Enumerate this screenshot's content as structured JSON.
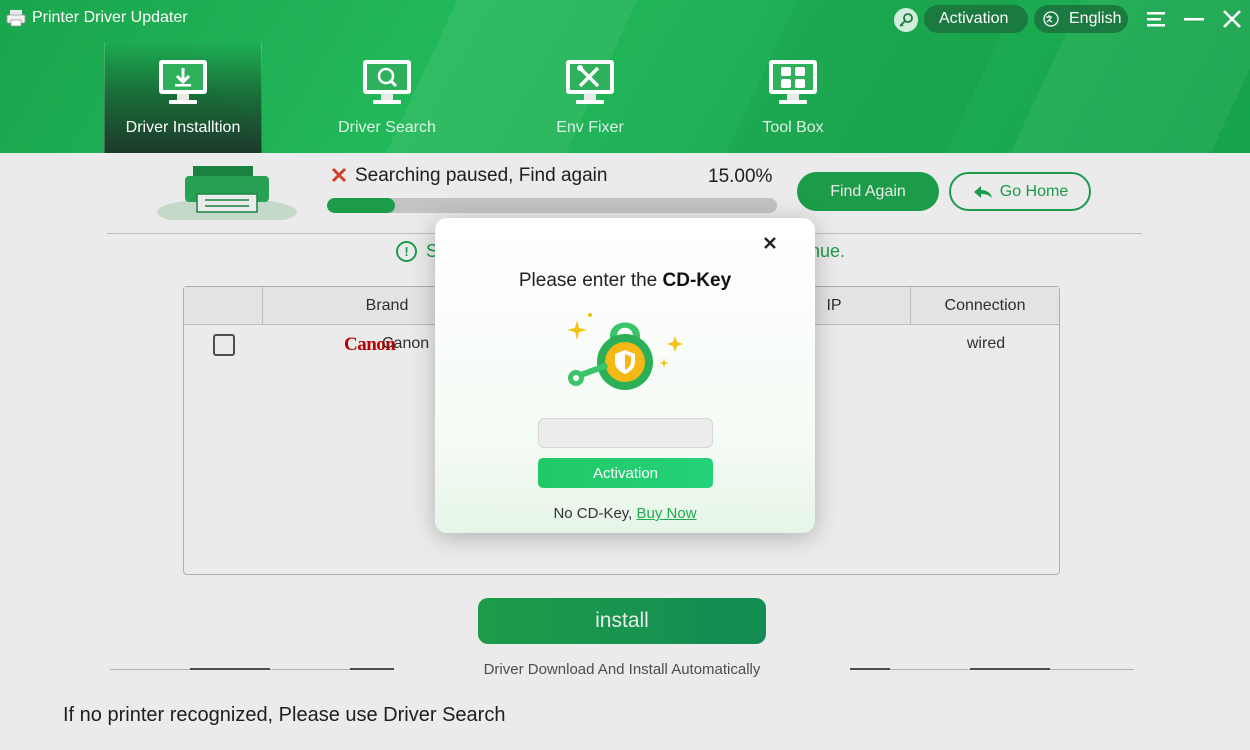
{
  "window": {
    "title": "Printer Driver Updater",
    "activation_label": "Activation",
    "language_label": "English"
  },
  "nav_tabs": [
    {
      "label": "Driver Installtion",
      "active": true,
      "icon": "download-monitor-icon"
    },
    {
      "label": "Driver Search",
      "active": false,
      "icon": "search-monitor-icon"
    },
    {
      "label": "Env Fixer",
      "active": false,
      "icon": "tools-monitor-icon"
    },
    {
      "label": "Tool Box",
      "active": false,
      "icon": "grid-monitor-icon"
    }
  ],
  "scan": {
    "status_text": "Searching paused, Find again",
    "percent_text": "15.00%",
    "progress_fraction": 0.15,
    "find_again_label": "Find Again",
    "go_home_label": "Go Home",
    "info_visible_start": "S",
    "info_visible_end": "nue."
  },
  "table": {
    "columns": [
      "Brand",
      "IP",
      "Connection"
    ],
    "rows": [
      {
        "brand_logo": "Canon",
        "brand": "Canon",
        "connection": "wired",
        "checked": false
      }
    ]
  },
  "install": {
    "button_label": "install",
    "subtitle": "Driver Download And Install Automatically"
  },
  "bottom_tip": "If no printer recognized, Please use Driver Search",
  "modal": {
    "title_prefix": "Please enter the",
    "title_bold": "CD-Key",
    "input_value": "",
    "input_placeholder": "",
    "activation_button": "Activation",
    "footer_text": "No CD-Key,",
    "buy_now_link": "Buy Now"
  },
  "colors": {
    "brand_green": "#1faa50",
    "header_green": "#22b85a",
    "nav_active_bg": "#1d3a2a",
    "canon_red": "#cc0000"
  }
}
